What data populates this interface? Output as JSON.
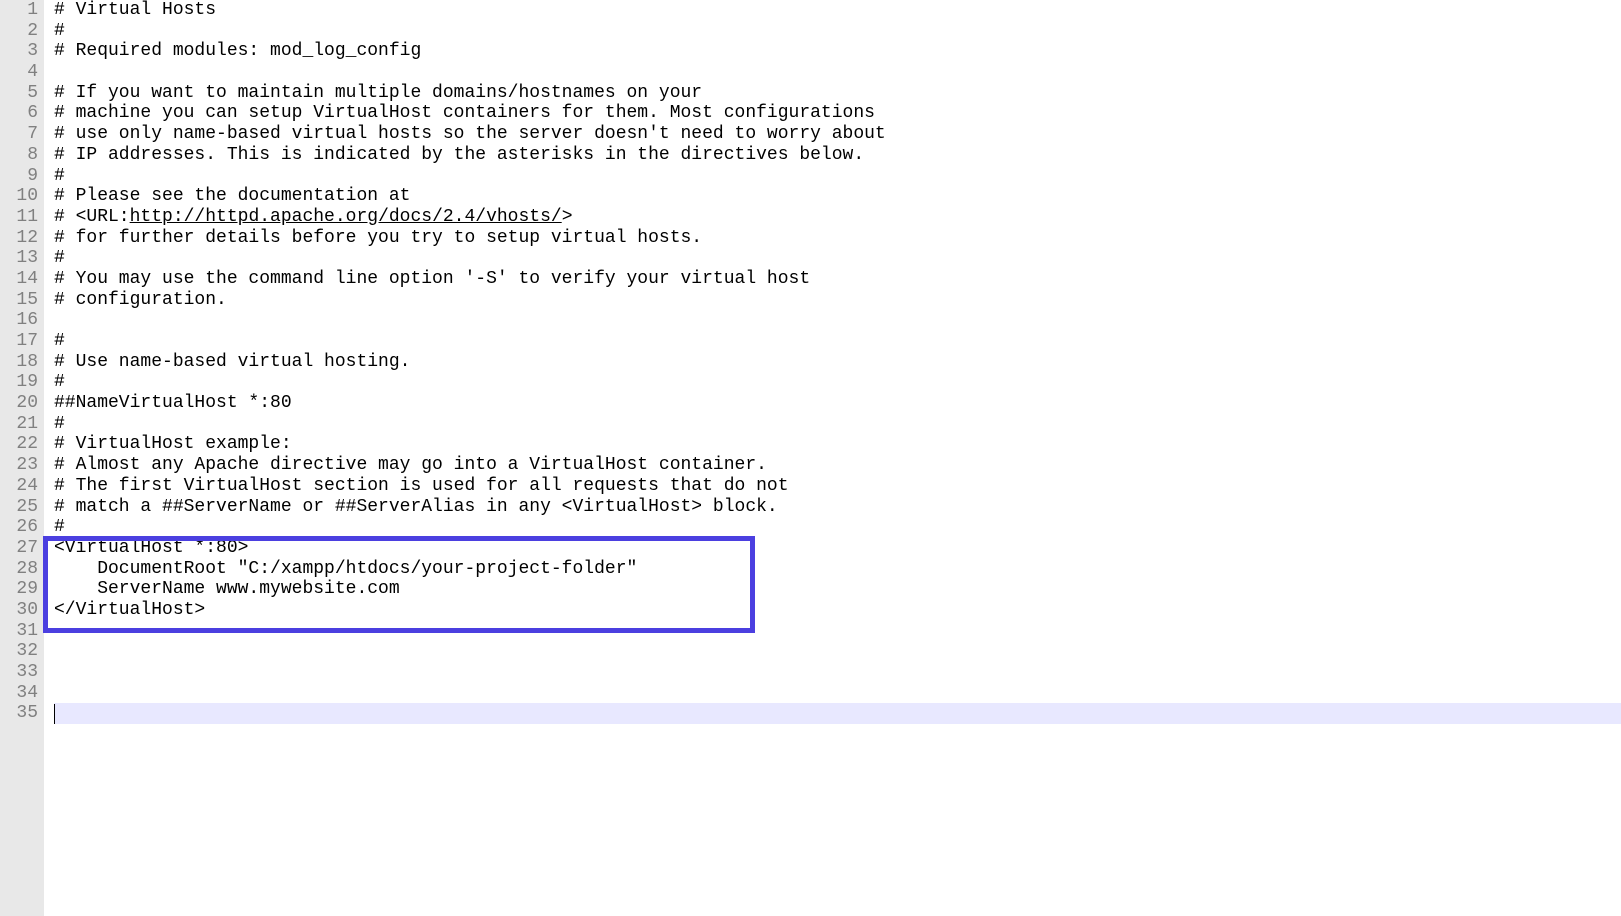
{
  "editor": {
    "total_lines": 35,
    "cursor_line": 35,
    "highlight_start": 27,
    "highlight_end": 30,
    "url_text": "http://httpd.apache.org/docs/2.4/vhosts/",
    "lines": {
      "1": "# Virtual Hosts",
      "2": "#",
      "3": "# Required modules: mod_log_config",
      "4": "",
      "5": "# If you want to maintain multiple domains/hostnames on your",
      "6": "# machine you can setup VirtualHost containers for them. Most configurations",
      "7": "# use only name-based virtual hosts so the server doesn't need to worry about",
      "8": "# IP addresses. This is indicated by the asterisks in the directives below.",
      "9": "#",
      "10": "# Please see the documentation at",
      "11_pre": "# <URL:",
      "11_post": ">",
      "12": "# for further details before you try to setup virtual hosts.",
      "13": "#",
      "14": "# You may use the command line option '-S' to verify your virtual host",
      "15": "# configuration.",
      "16": "",
      "17": "#",
      "18": "# Use name-based virtual hosting.",
      "19": "#",
      "20": "##NameVirtualHost *:80",
      "21": "#",
      "22": "# VirtualHost example:",
      "23": "# Almost any Apache directive may go into a VirtualHost container.",
      "24": "# The first VirtualHost section is used for all requests that do not",
      "25": "# match a ##ServerName or ##ServerAlias in any <VirtualHost> block.",
      "26": "#",
      "27": "<VirtualHost *:80>",
      "28": "    DocumentRoot \"C:/xampp/htdocs/your-project-folder\"",
      "29": "    ServerName www.mywebsite.com",
      "30": "</VirtualHost>",
      "31": "",
      "32": "",
      "33": "",
      "34": "",
      "35": ""
    }
  }
}
